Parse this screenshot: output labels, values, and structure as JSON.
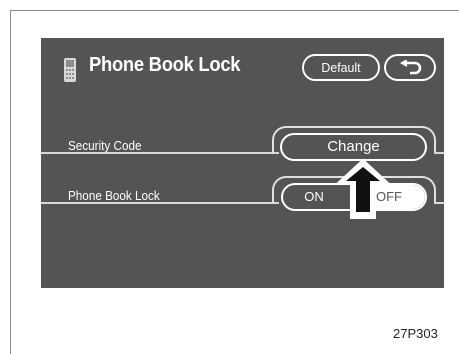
{
  "screen": {
    "title": "Phone Book Lock",
    "title_icon": "phone-icon",
    "buttons": {
      "default_label": "Default",
      "back_icon": "back-arrow-icon"
    },
    "rows": [
      {
        "label": "Security Code",
        "control": "button",
        "button_label": "Change"
      },
      {
        "label": "Phone Book Lock",
        "control": "toggle",
        "on_label": "ON",
        "off_label": "OFF",
        "selected": "OFF"
      }
    ],
    "pointer": "up-arrow-indicator"
  },
  "caption": "27P303",
  "colors": {
    "screen_bg": "#545454",
    "text": "#ffffff",
    "selected_toggle_bg": "#ffffff"
  }
}
